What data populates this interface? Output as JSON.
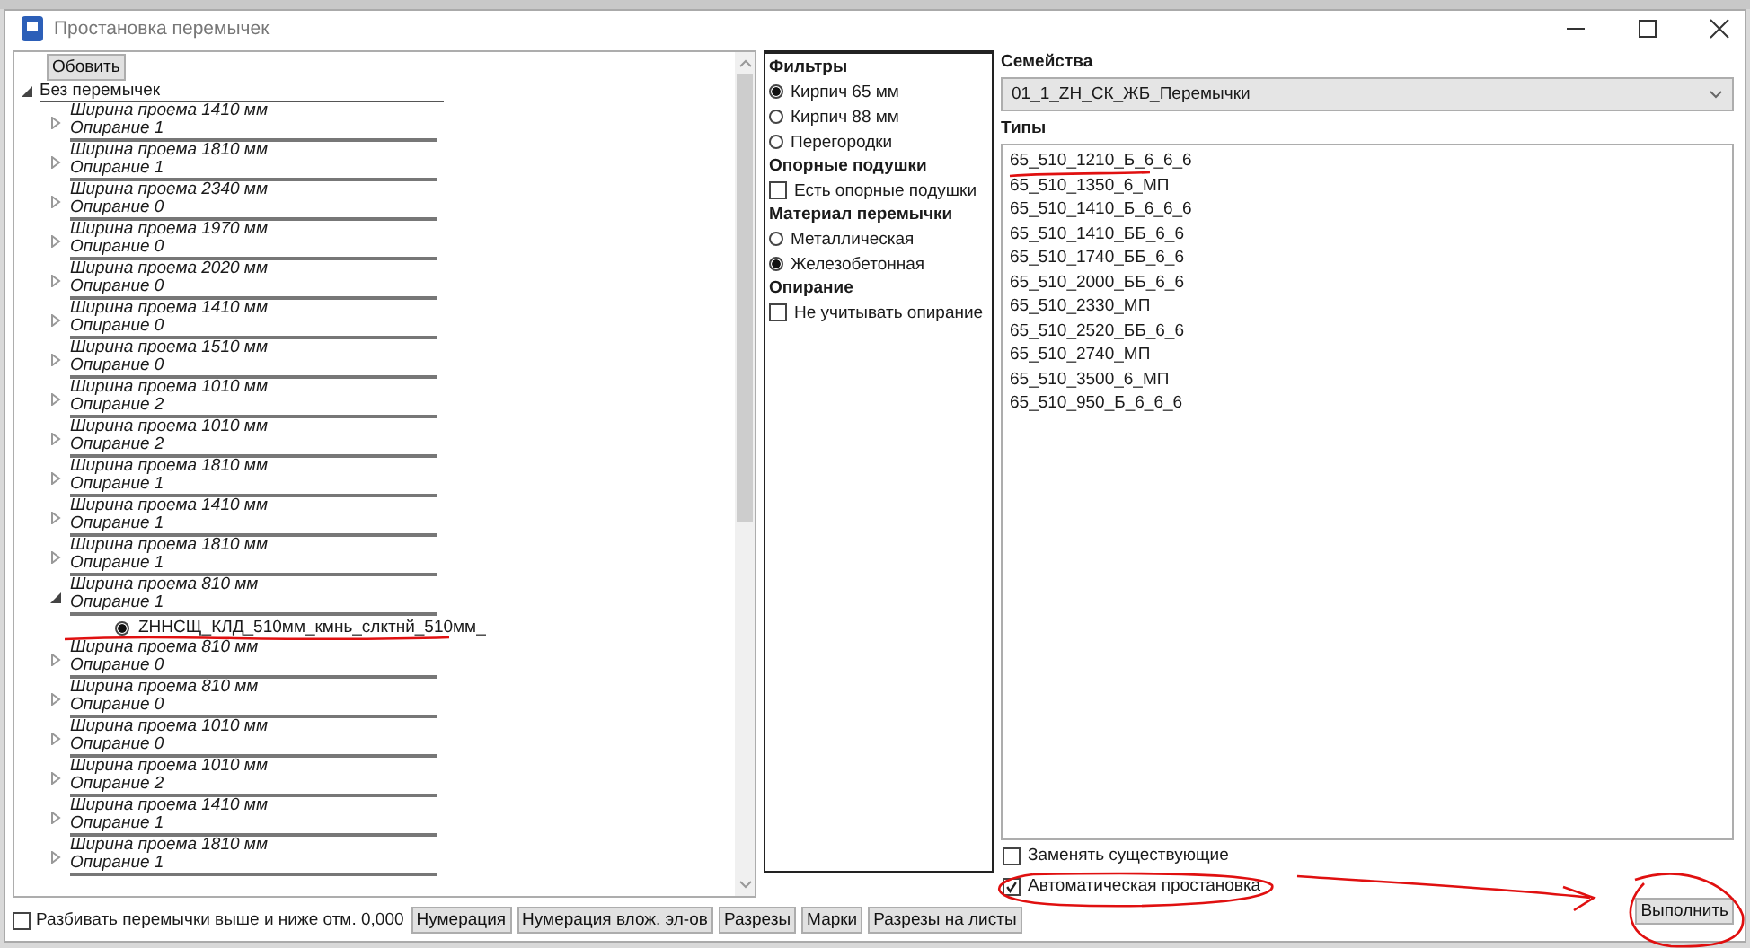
{
  "window": {
    "title": "Простановка перемычек"
  },
  "refresh_button": "Обовить",
  "tree": {
    "label": "Без перемычек",
    "expanded": true,
    "children": [
      {
        "width": "Ширина проема 1410 мм",
        "support": "Опирание 1",
        "expanded": false
      },
      {
        "width": "Ширина проема 1810 мм",
        "support": "Опирание 1",
        "expanded": false
      },
      {
        "width": "Ширина проема 2340 мм",
        "support": "Опирание 0",
        "expanded": false
      },
      {
        "width": "Ширина проема 1970 мм",
        "support": "Опирание 0",
        "expanded": false
      },
      {
        "width": "Ширина проема 2020 мм",
        "support": "Опирание 0",
        "expanded": false
      },
      {
        "width": "Ширина проема 1410 мм",
        "support": "Опирание 0",
        "expanded": false
      },
      {
        "width": "Ширина проема 1510 мм",
        "support": "Опирание 0",
        "expanded": false
      },
      {
        "width": "Ширина проема 1010 мм",
        "support": "Опирание 2",
        "expanded": false
      },
      {
        "width": "Ширина проема 1010 мм",
        "support": "Опирание 2",
        "expanded": false
      },
      {
        "width": "Ширина проема 1810 мм",
        "support": "Опирание 1",
        "expanded": false
      },
      {
        "width": "Ширина проема 1410 мм",
        "support": "Опирание 1",
        "expanded": false
      },
      {
        "width": "Ширина проема 1810 мм",
        "support": "Опирание 1",
        "expanded": false
      },
      {
        "width": "Ширина проема 810 мм",
        "support": "Опирание 1",
        "expanded": true,
        "children": [
          {
            "label": "ZHНСЩ_КЛД_510мм_кмнь_слктнй_510мм_",
            "selected": true
          }
        ]
      },
      {
        "width": "Ширина проема 810 мм",
        "support": "Опирание 0",
        "expanded": false
      },
      {
        "width": "Ширина проема 810 мм",
        "support": "Опирание 0",
        "expanded": false
      },
      {
        "width": "Ширина проема 1010 мм",
        "support": "Опирание 0",
        "expanded": false
      },
      {
        "width": "Ширина проема 1010 мм",
        "support": "Опирание 2",
        "expanded": false
      },
      {
        "width": "Ширина проема 1410 мм",
        "support": "Опирание 1",
        "expanded": false
      },
      {
        "width": "Ширина проема 1810 мм",
        "support": "Опирание 1",
        "expanded": false
      }
    ]
  },
  "filters": [
    {
      "kind": "heading",
      "label": "Фильтры"
    },
    {
      "kind": "radio",
      "label": "Кирпич 65 мм",
      "selected": true
    },
    {
      "kind": "radio",
      "label": "Кирпич 88 мм",
      "selected": false
    },
    {
      "kind": "radio",
      "label": "Перегородки",
      "selected": false
    },
    {
      "kind": "heading",
      "label": "Опорные подушки"
    },
    {
      "kind": "checkbox",
      "label": "Есть опорные подушки",
      "checked": false
    },
    {
      "kind": "heading",
      "label": "Материал перемычки"
    },
    {
      "kind": "radio",
      "label": "Металлическая",
      "selected": false
    },
    {
      "kind": "radio",
      "label": "Железобетонная",
      "selected": true
    },
    {
      "kind": "heading",
      "label": "Опирание"
    },
    {
      "kind": "checkbox",
      "label": "Не учитывать опирание",
      "checked": false
    }
  ],
  "families": {
    "label": "Семейства",
    "value": "01_1_ZH_СК_ЖБ_Перемычки"
  },
  "types": {
    "label": "Типы",
    "items": [
      {
        "label": "65_510_1210_Б_6_6_6",
        "selected": false
      },
      {
        "label": "65_510_1350_6_МП",
        "selected": false
      },
      {
        "label": "65_510_1410_Б_6_6_6",
        "selected": false
      },
      {
        "label": "65_510_1410_ББ_6_6",
        "selected": false
      },
      {
        "label": "65_510_1740_ББ_6_6",
        "selected": false
      },
      {
        "label": "65_510_2000_ББ_6_6",
        "selected": false
      },
      {
        "label": "65_510_2330_МП",
        "selected": false
      },
      {
        "label": "65_510_2520_ББ_6_6",
        "selected": false
      },
      {
        "label": "65_510_2740_МП",
        "selected": false
      },
      {
        "label": "65_510_3500_6_МП",
        "selected": false
      },
      {
        "label": "65_510_950_Б_6_6_6",
        "selected": false
      }
    ]
  },
  "options": [
    {
      "label": "Заменять существующие",
      "checked": false
    },
    {
      "label": "Автоматическая простановка",
      "checked": true
    }
  ],
  "split_checkbox": {
    "label": "Разбивать перемычки выше и ниже отм. 0,000",
    "checked": false
  },
  "bottom_buttons": [
    "Нумерация",
    "Нумерация влож. эл-ов",
    "Разрезы",
    "Марки",
    "Разрезы на листы"
  ],
  "run_button": "Выполнить"
}
